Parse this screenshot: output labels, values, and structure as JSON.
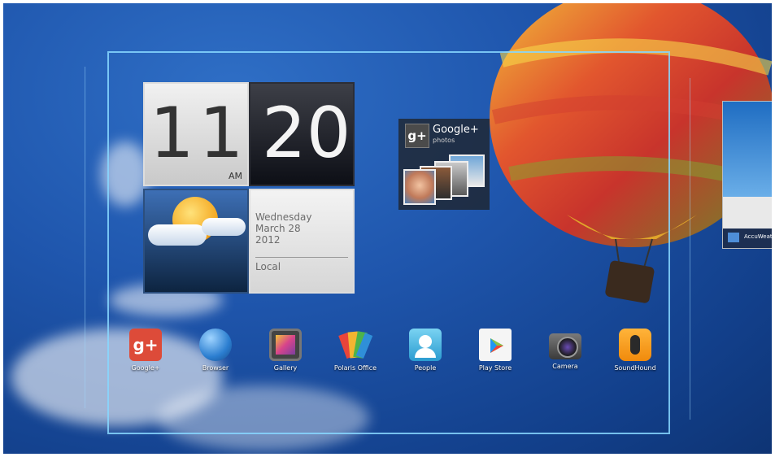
{
  "clock": {
    "hour": "11",
    "minute": "20",
    "ampm": "AM"
  },
  "weather": {
    "day": "Wednesday",
    "date": "March 28",
    "year": "2012",
    "location": "Local"
  },
  "gplus": {
    "title": "Google+",
    "subtitle": "photos"
  },
  "preview": {
    "label": "AccuWeat"
  },
  "dock": [
    {
      "label": "Google+"
    },
    {
      "label": "Browser"
    },
    {
      "label": "Gallery"
    },
    {
      "label": "Polaris Office"
    },
    {
      "label": "People"
    },
    {
      "label": "Play Store"
    },
    {
      "label": "Camera"
    },
    {
      "label": "SoundHound"
    }
  ],
  "colors": {
    "wallpaper": "#1f56ad",
    "frame": "#87d7ff",
    "gplus_red": "#dd4b39",
    "soundhound": "#f59a13"
  }
}
